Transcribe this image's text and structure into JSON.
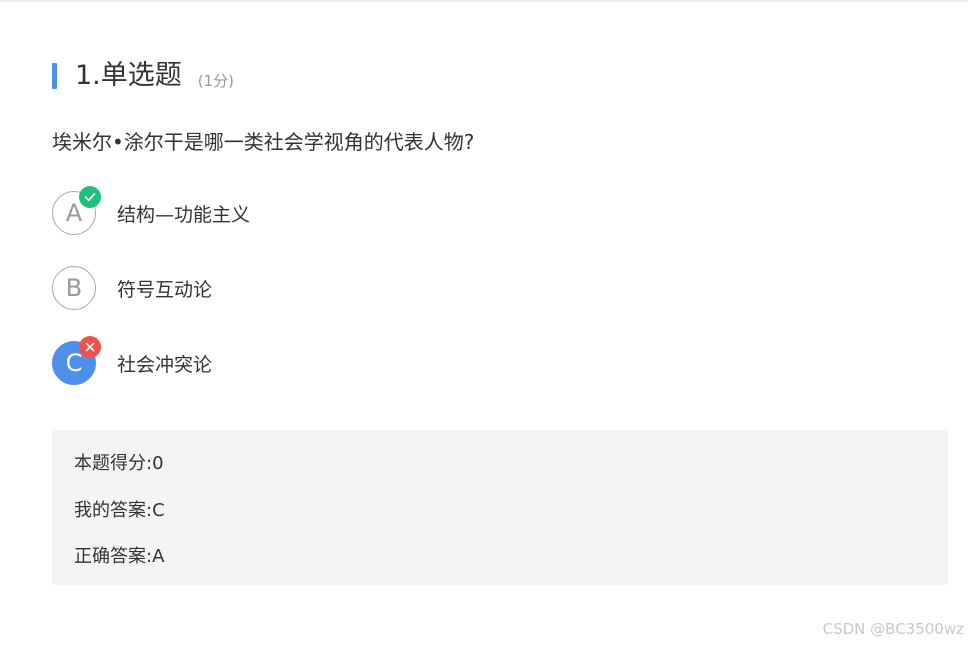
{
  "question": {
    "title": "1.单选题",
    "score": "(1分)",
    "stem": "埃米尔•涂尔干是哪一类社会学视角的代表人物?",
    "options": [
      {
        "letter": "A",
        "text": "结构—功能主义",
        "mark": "check-icon",
        "chosen": false
      },
      {
        "letter": "B",
        "text": "符号互动论",
        "mark": null,
        "chosen": false
      },
      {
        "letter": "C",
        "text": "社会冲突论",
        "mark": "cross-icon",
        "chosen": true
      }
    ]
  },
  "result": {
    "score_line": "本题得分:0",
    "my_answer_line": "我的答案:C",
    "correct_answer_line": "正确答案:A"
  },
  "watermark": "CSDN @BC3500wz",
  "colors": {
    "accent": "#4f8fec",
    "correct": "#1ec07b",
    "wrong": "#f2514a",
    "panel": "#f4f4f4"
  }
}
